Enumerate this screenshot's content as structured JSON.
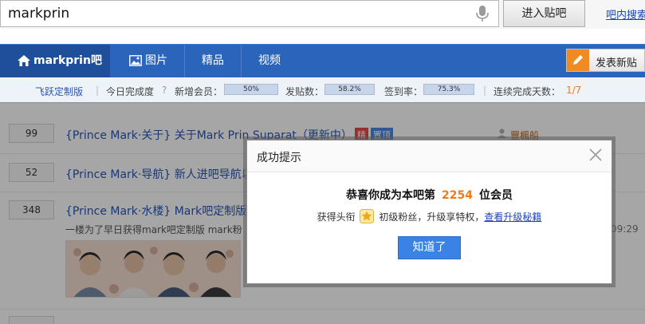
{
  "search": {
    "value": "markprin",
    "enter_label": "进入贴吧",
    "search_in_bar_link": "吧内搜索"
  },
  "nav": {
    "bar_name": "markprin吧",
    "tabs": [
      {
        "label": "图片"
      },
      {
        "label": "精品"
      },
      {
        "label": "视频"
      }
    ],
    "post_button": "发表新贴"
  },
  "stats": {
    "custom_label": "飞跃定制版",
    "today_label": "今日完成度",
    "new_members_label": "新增会员：",
    "new_members_pct": "50%",
    "new_members_frac": 0.5,
    "posts_label": "发贴数：",
    "posts_pct": "58.2%",
    "posts_frac": 0.582,
    "signin_label": "签到率：",
    "signin_pct": "75.3%",
    "signin_frac": 0.753,
    "streak_label": "连续完成天数：",
    "streak_value": "1/7"
  },
  "threads": [
    {
      "count": "99",
      "title": "{Prince Mark·关于} 关于Mark Prin Suparat（更新中）",
      "badge_good": "精",
      "badge_top": "置顶",
      "author": "豐楓船"
    },
    {
      "count": "52",
      "title": "{Prince Mark·导航} 新人进吧导航以"
    },
    {
      "count": "348",
      "title": "{Prince Mark·水楼} Mark吧定制版第",
      "preview": "一楼为了早日获得mark吧定制版 mark粉",
      "time": "09:29"
    }
  ],
  "dialog": {
    "title": "成功提示",
    "congrats_prefix": "恭喜你成为本吧第",
    "member_number": "2254",
    "congrats_suffix": "位会员",
    "title_prefix": "获得头衔",
    "rank": "初级粉丝，升级享特权，",
    "upgrade_link": "查看升级秘籍",
    "ok_button": "知道了"
  },
  "colors": {
    "nav_blue": "#2b65bb",
    "accent_orange": "#ee7b1b",
    "button_blue": "#3a82e6",
    "link_blue": "#2a55b3"
  }
}
